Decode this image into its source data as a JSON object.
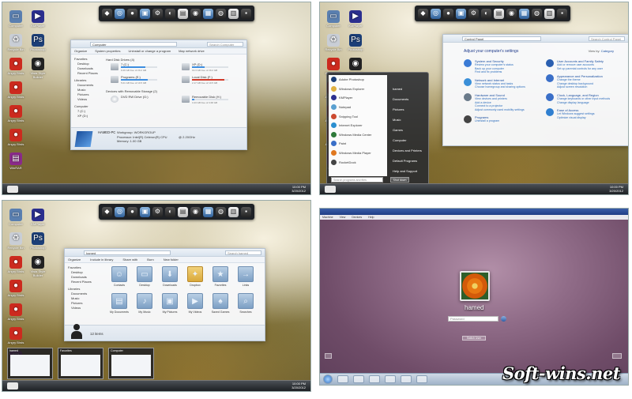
{
  "desktop_icons": [
    {
      "label": "Computer",
      "icon": "computer-icon",
      "color": "#5a7fb0"
    },
    {
      "label": "KMPlayer",
      "icon": "kmplayer-icon",
      "color": "#2b2f8f"
    },
    {
      "label": "Recycle Bin",
      "icon": "recycle-bin-icon",
      "color": "#c9ced6"
    },
    {
      "label": "Photoshop",
      "icon": "photoshop-icon",
      "color": "#1c3f78"
    },
    {
      "label": "Angry Birds",
      "icon": "angry-birds-icon",
      "color": "#cc2a1e"
    },
    {
      "label": "Vista Style Builder",
      "icon": "vsb-icon",
      "color": "#222222"
    },
    {
      "label": "Angry Birds",
      "icon": "angry-birds-icon",
      "color": "#cc2a1e"
    },
    {
      "label": "Angry Birds",
      "icon": "angry-birds-icon",
      "color": "#cc2a1e"
    },
    {
      "label": "Angry Birds",
      "icon": "angry-birds-icon",
      "color": "#cc2a1e"
    },
    {
      "label": "WinRAR",
      "icon": "winrar-icon",
      "color": "#8a2a8a"
    }
  ],
  "taskbar": {
    "clock_time": "10:00 PM",
    "clock_date": "3/20/2012"
  },
  "computer_window": {
    "address": "Computer",
    "search_placeholder": "Search Computer",
    "commands": [
      "Organize",
      "System properties",
      "Uninstall or change a program",
      "Map network drive"
    ],
    "nav": [
      "Favorites",
      "Desktop",
      "Downloads",
      "Recent Places",
      "Libraries",
      "Documents",
      "Music",
      "Pictures",
      "Videos",
      "Computer",
      "7 (C:)",
      "XP (D:)"
    ],
    "hdd_header": "Hard Disk Drives (4)",
    "removable_header": "Devices with Removable Storage (2)",
    "drives": [
      {
        "name": "7 (C:)",
        "detail": "9.26 GB free of 29.2 GB",
        "used": 0.68
      },
      {
        "name": "XP (D:)",
        "detail": "19.3 GB free of 29.2 GB",
        "used": 0.34
      },
      {
        "name": "Programs (E:)",
        "detail": "5.01 GB free of 19.5 GB",
        "used": 0.74
      },
      {
        "name": "Local Disk (F:)",
        "detail": "2.17 GB free of 19.5 GB",
        "used": 0.89
      },
      {
        "name": "DVD RW Drive (G:)",
        "detail": "",
        "used": 0
      },
      {
        "name": "Removable Disk (H:)",
        "detail": "3.43 GB free of 3.68 GB",
        "used": 0.07
      }
    ],
    "pc_name": "HAMED-PC",
    "workgroup": "Workgroup: WORKGROUP",
    "processor": "Processor: Intel(R) Celeron(R) CPU",
    "memory": "Memory: 1.00 GB",
    "cpu_speed": "@ 2.20GHz"
  },
  "control_panel": {
    "address": "Control Panel",
    "search_placeholder": "Search Control Panel",
    "heading": "Adjust your computer's settings",
    "view_by_label": "View by:",
    "view_by_value": "Category",
    "categories": [
      {
        "title": "System and Security",
        "links": [
          "Review your computer's status",
          "Back up your computer",
          "Find and fix problems"
        ],
        "color": "#3a7bd5"
      },
      {
        "title": "Network and Internet",
        "links": [
          "View network status and tasks",
          "Choose homegroup and sharing options"
        ],
        "color": "#3a8fd8"
      },
      {
        "title": "Hardware and Sound",
        "links": [
          "View devices and printers",
          "Add a device",
          "Connect to a projector",
          "Adjust commonly used mobility settings"
        ],
        "color": "#6a7a8a"
      },
      {
        "title": "Programs",
        "links": [
          "Uninstall a program"
        ],
        "color": "#444444"
      },
      {
        "title": "User Accounts and Family Safety",
        "links": [
          "Add or remove user accounts",
          "Set up parental controls for any user"
        ],
        "color": "#2a5fb0"
      },
      {
        "title": "Appearance and Personalization",
        "links": [
          "Change the theme",
          "Change desktop background",
          "Adjust screen resolution"
        ],
        "color": "#3a6fc8"
      },
      {
        "title": "Clock, Language, and Region",
        "links": [
          "Change keyboards or other input methods",
          "Change display language"
        ],
        "color": "#3a6fc8"
      },
      {
        "title": "Ease of Access",
        "links": [
          "Let Windows suggest settings",
          "Optimize visual display"
        ],
        "color": "#2f7fd0"
      }
    ]
  },
  "start_menu": {
    "programs": [
      "Adobe Photoshop",
      "Windows Explorer",
      "KMPlayer",
      "Notepad",
      "Snipping Tool",
      "Internet Explorer",
      "Windows Media Center",
      "Paint",
      "Windows Media Player",
      "RocketDock"
    ],
    "places": [
      "hamed",
      "Documents",
      "Pictures",
      "Music",
      "Games",
      "Computer",
      "Devices and Printers",
      "Default Programs",
      "Help and Support"
    ],
    "search_placeholder": "Search programs and files",
    "shutdown_label": "Shut down"
  },
  "user_folder": {
    "address": "hamed",
    "search_placeholder": "Search hamed",
    "commands": [
      "Organize",
      "Include in library",
      "Share with",
      "Burn",
      "New folder"
    ],
    "nav": [
      "Favorites",
      "Desktop",
      "Downloads",
      "Recent Places",
      "Libraries",
      "Documents",
      "Music",
      "Pictures",
      "Videos"
    ],
    "folders": [
      "Contacts",
      "Desktop",
      "Downloads",
      "Dropbox",
      "Favorites",
      "Links",
      "My Documents",
      "My Music",
      "My Pictures",
      "My Videos",
      "Saved Games",
      "Searches"
    ],
    "item_count": "12 items",
    "thumbnail_titles": [
      "hamed",
      "Favorites",
      "Computer"
    ]
  },
  "login": {
    "menu_items": [
      "Machine",
      "View",
      "Devices",
      "Help"
    ],
    "username": "hamed",
    "password_placeholder": "Password",
    "switch_user_label": "Switch User"
  },
  "watermark": "Soft-wins.net"
}
